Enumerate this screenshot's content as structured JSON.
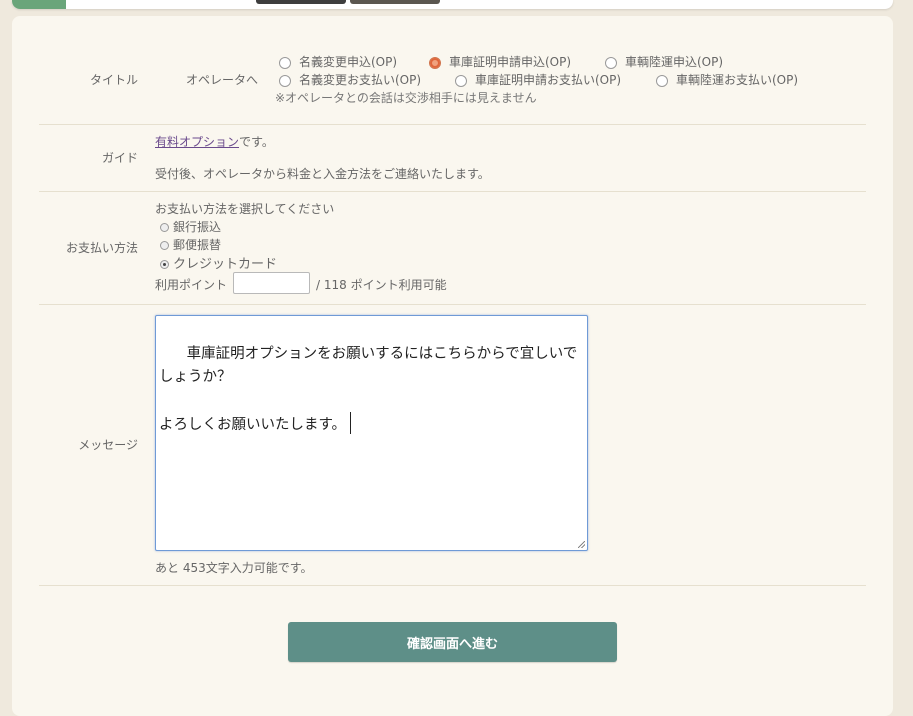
{
  "form": {
    "title_label": "タイトル",
    "operator_label": "オペレータへ",
    "title_options": [
      {
        "label": "名義変更申込(OP)",
        "selected": false
      },
      {
        "label": "車庫証明申請申込(OP)",
        "selected": true
      },
      {
        "label": "車輌陸運申込(OP)",
        "selected": false
      },
      {
        "label": "名義変更お支払い(OP)",
        "selected": false
      },
      {
        "label": "車庫証明申請お支払い(OP)",
        "selected": false
      },
      {
        "label": "車輌陸運お支払い(OP)",
        "selected": false
      }
    ],
    "operator_note": "※オペレータとの会話は交渉相手には見えません",
    "guide_label": "ガイド",
    "guide_link": "有料オプション",
    "guide_link_suffix": "です。",
    "guide_text": "受付後、オペレータから料金と入金方法をご連絡いたします。",
    "payment_label": "お支払い方法",
    "payment_prompt": "お支払い方法を選択してください",
    "payment_options": [
      {
        "label": "銀行振込",
        "selected": false
      },
      {
        "label": "郵便振替",
        "selected": false
      },
      {
        "label": "クレジットカード",
        "selected": true
      }
    ],
    "points_label": "利用ポイント",
    "points_value": "",
    "points_available": "/ 118 ポイント利用可能",
    "message_label": "メッセージ",
    "message_value": "車庫証明オプションをお願いするにはこちらからで宜しいでしょうか？\n\nよろしくお願いいたします。",
    "remaining_chars": "あと 453文字入力可能です。",
    "submit_label": "確認画面へ進む"
  },
  "colors": {
    "background": "#efe9dd",
    "panel": "#faf7ef",
    "submit": "#5e8f88",
    "accent_radio": "#e0663b",
    "link": "#6a4a8c"
  }
}
